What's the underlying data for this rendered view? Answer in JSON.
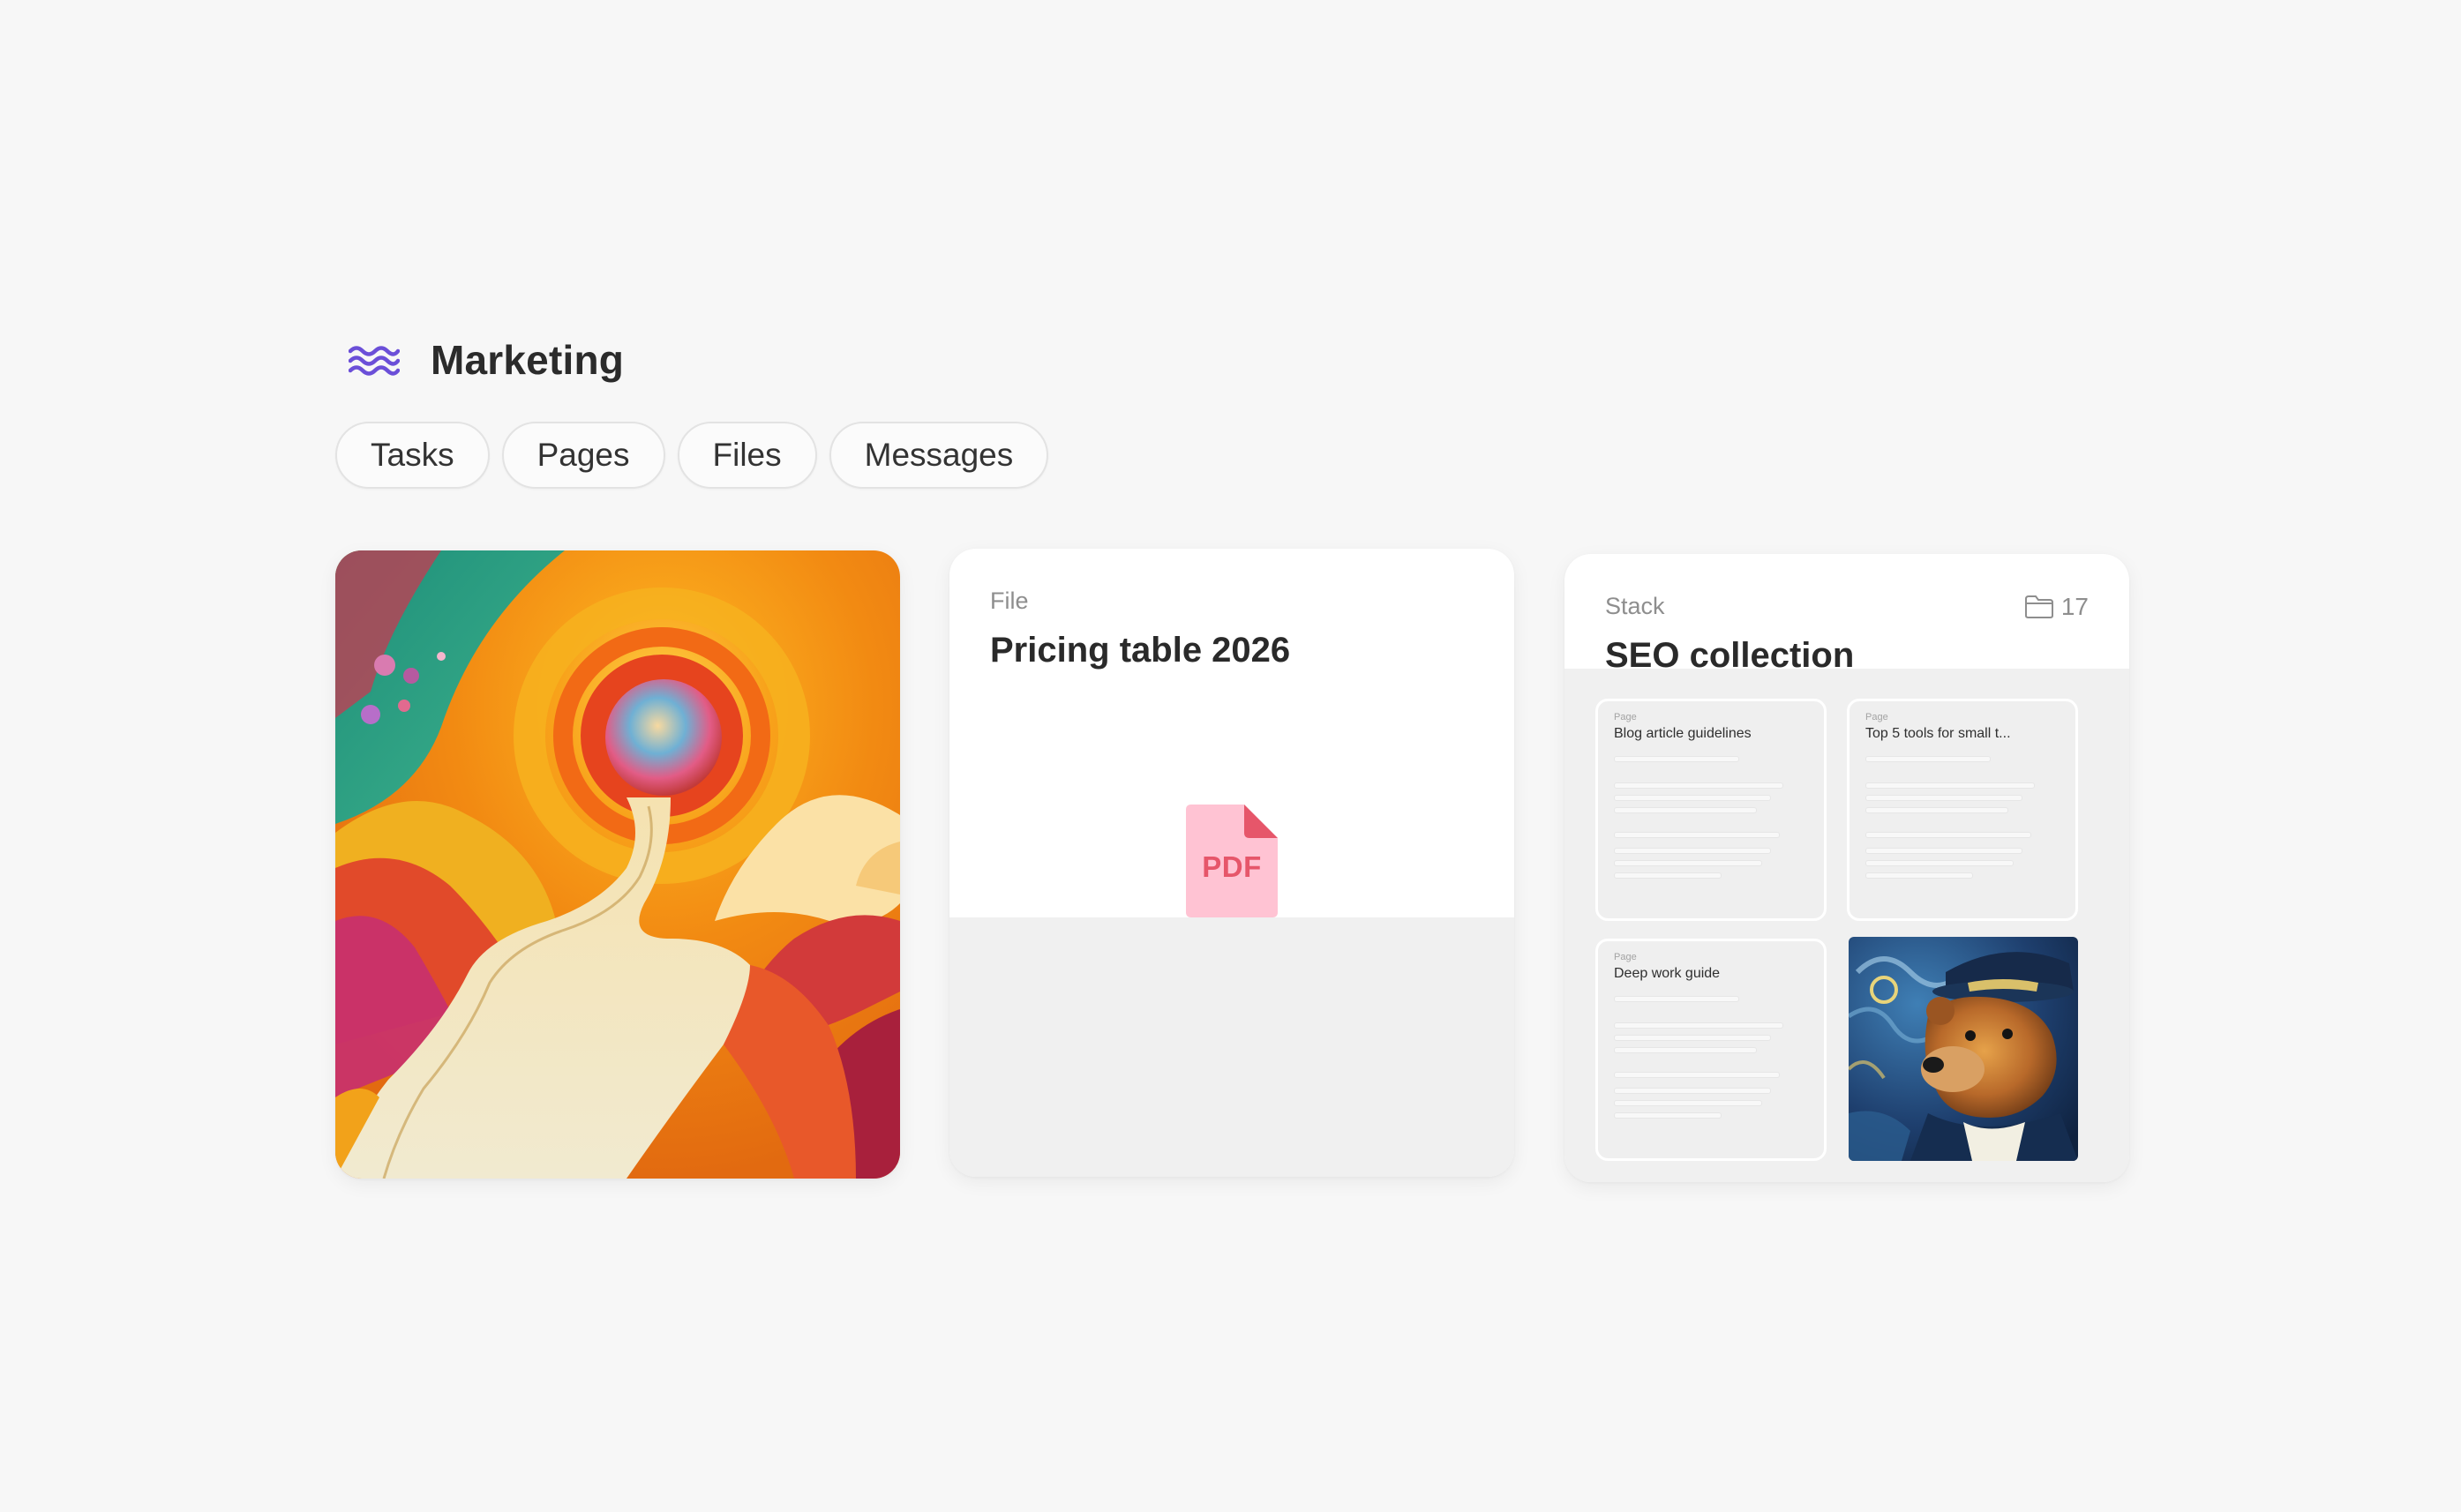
{
  "workspace": {
    "title": "Marketing",
    "logo_icon": "wave-logo-icon",
    "accent_color": "#6b4fd8"
  },
  "tabs": [
    {
      "label": "Tasks"
    },
    {
      "label": "Pages"
    },
    {
      "label": "Files"
    },
    {
      "label": "Messages"
    }
  ],
  "cards": {
    "image": {
      "kind": "image",
      "description_icon": "winding-road-painting"
    },
    "file": {
      "kind_label": "File",
      "title": "Pricing table 2026",
      "file_type": "PDF",
      "file_icon_color": "#ffc3d3",
      "file_text_color": "#e6566a"
    },
    "stack": {
      "kind_label": "Stack",
      "title": "SEO collection",
      "count": "17",
      "items": [
        {
          "kind": "Page",
          "title": "Blog article guidelines"
        },
        {
          "kind": "Page",
          "title": "Top 5 tools for small t..."
        },
        {
          "kind": "Page",
          "title": "Deep work guide"
        },
        {
          "kind": "image",
          "title": ""
        }
      ]
    }
  }
}
